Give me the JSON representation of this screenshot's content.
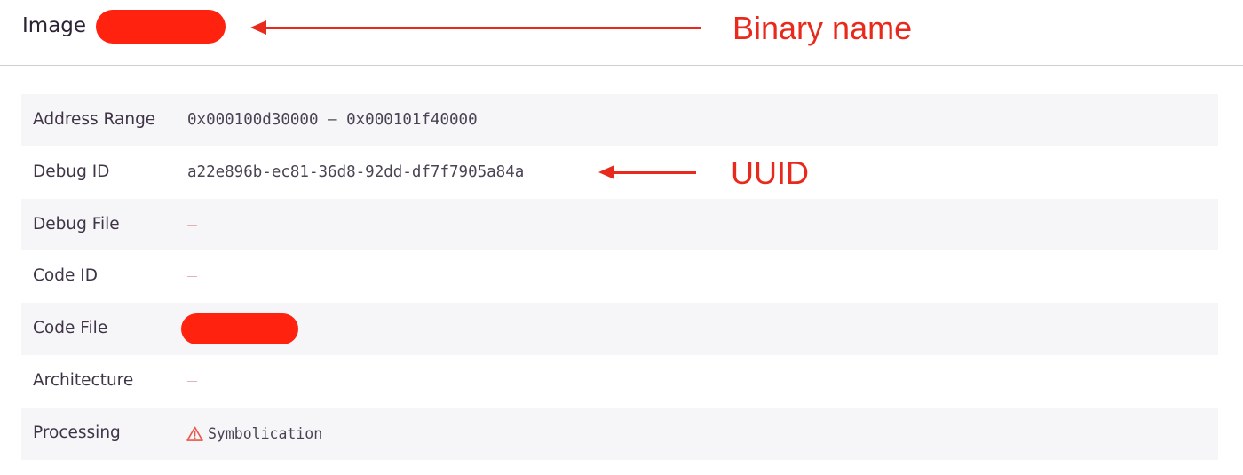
{
  "header": {
    "title": "Image"
  },
  "annotations": {
    "binary_name": "Binary name",
    "uuid": "UUID",
    "color": "#e82a1c"
  },
  "rows": [
    {
      "key": "Address Range",
      "value": "0x000100d30000 – 0x000101f40000"
    },
    {
      "key": "Debug ID",
      "value": "a22e896b-ec81-36d8-92dd-df7f7905a84a"
    },
    {
      "key": "Debug File",
      "value": ""
    },
    {
      "key": "Code ID",
      "value": ""
    },
    {
      "key": "Code File",
      "value": ""
    },
    {
      "key": "Architecture",
      "value": ""
    },
    {
      "key": "Processing",
      "value": "Symbolication",
      "icon": "warning-icon"
    }
  ],
  "colors": {
    "redaction": "#ff220f",
    "row_shade": "#f6f5f8",
    "warning": "#e8574b"
  }
}
